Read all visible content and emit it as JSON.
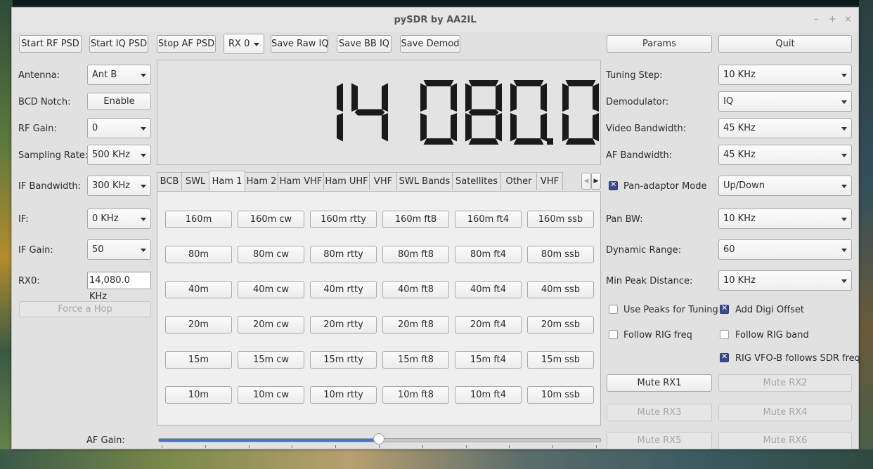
{
  "window": {
    "title": "pySDR by AA2IL",
    "controls": [
      "–",
      "+",
      "×"
    ]
  },
  "toolbar": [
    {
      "label": "Start RF PSD"
    },
    {
      "label": "Start IQ PSD"
    },
    {
      "label": "Stop AF PSD"
    },
    {
      "label": "RX 0",
      "type": "combo"
    },
    {
      "label": "Save Raw IQ"
    },
    {
      "label": "Save BB IQ"
    },
    {
      "label": "Save Demod"
    }
  ],
  "top_right": {
    "params": "Params",
    "quit": "Quit"
  },
  "left": {
    "antenna": {
      "label": "Antenna:",
      "value": "Ant B"
    },
    "bcd_notch": {
      "label": "BCD Notch:",
      "button": "Enable"
    },
    "rf_gain": {
      "label": "RF Gain:",
      "value": "0"
    },
    "sampling_rate": {
      "label": "Sampling Rate:",
      "value": "500 KHz"
    },
    "if_bandwidth": {
      "label": "IF Bandwidth:",
      "value": "300 KHz"
    },
    "if": {
      "label": "IF:",
      "value": "0 KHz"
    },
    "if_gain": {
      "label": "IF Gain:",
      "value": "50"
    },
    "rx0": {
      "label": "RX0:",
      "value": "14,080.0 KHz"
    },
    "force_hop": "Force a Hop"
  },
  "frequency_display": "14 080.0",
  "tabs": [
    "BCB",
    "SWL",
    "Ham 1",
    "Ham 2",
    "Ham VHF",
    "Ham UHF",
    "VHF",
    "SWL Bands",
    "Satellites",
    "Other",
    "VHF"
  ],
  "active_tab": "Ham 1",
  "band_buttons": [
    [
      "160m",
      "160m cw",
      "160m rtty",
      "160m ft8",
      "160m ft4",
      "160m ssb"
    ],
    [
      "80m",
      "80m cw",
      "80m rtty",
      "80m ft8",
      "80m ft4",
      "80m ssb"
    ],
    [
      "40m",
      "40m cw",
      "40m rtty",
      "40m ft8",
      "40m ft4",
      "40m ssb"
    ],
    [
      "20m",
      "20m cw",
      "20m rtty",
      "20m ft8",
      "20m ft4",
      "20m ssb"
    ],
    [
      "15m",
      "15m cw",
      "15m rtty",
      "15m ft8",
      "15m ft4",
      "15m ssb"
    ],
    [
      "10m",
      "10m cw",
      "10m rtty",
      "10m ft8",
      "10m ft4",
      "10m ssb"
    ]
  ],
  "right": {
    "tuning_step": {
      "label": "Tuning Step:",
      "value": "10 KHz"
    },
    "demodulator": {
      "label": "Demodulator:",
      "value": "IQ"
    },
    "video_bandwidth": {
      "label": "Video Bandwidth:",
      "value": "45 KHz"
    },
    "af_bandwidth": {
      "label": "AF Bandwidth:",
      "value": "45 KHz"
    },
    "pan_adaptor": {
      "label": "Pan-adaptor Mode",
      "checked": true,
      "value": "Up/Down"
    },
    "pan_bw": {
      "label": "Pan BW:",
      "value": "10 KHz"
    },
    "dynamic_range": {
      "label": "Dynamic Range:",
      "value": "60"
    },
    "min_peak_distance": {
      "label": "Min Peak Distance:",
      "value": "10 KHz"
    },
    "use_peaks": {
      "label": "Use Peaks for Tuning",
      "checked": false
    },
    "add_digi_offset": {
      "label": "Add Digi Offset",
      "checked": true
    },
    "follow_rig_freq": {
      "label": "Follow RIG freq",
      "checked": false
    },
    "follow_rig_band": {
      "label": "Follow RIG band",
      "checked": false
    },
    "rig_vfo_b": {
      "label": "RIG VFO-B follows SDR freq",
      "checked": true
    },
    "mute": [
      "Mute RX1",
      "Mute RX2",
      "Mute RX3",
      "Mute RX4",
      "Mute RX5",
      "Mute RX6"
    ]
  },
  "af_gain": {
    "label": "AF Gain:",
    "level": 0.5,
    "tick_count": 11
  },
  "colors": {
    "accent": "#4a6fc4",
    "checkbox": "#3d4b8c",
    "segment": "#1a1a1a"
  }
}
